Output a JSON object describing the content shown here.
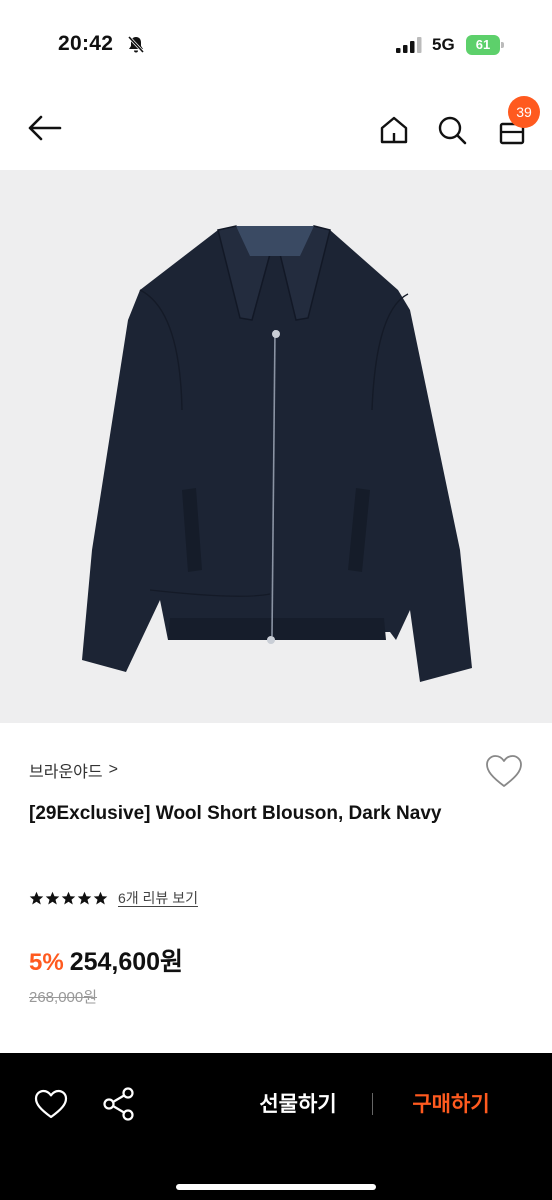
{
  "status_bar": {
    "time": "20:42",
    "network": "5G",
    "battery": "61"
  },
  "nav": {
    "cart_count": "39"
  },
  "product": {
    "brand": "브라운야드",
    "brand_chevron": ">",
    "title": "[29Exclusive] Wool Short Blouson, Dark Navy",
    "rating_stars": 5,
    "review_link": "6개 리뷰 보기",
    "discount": "5%",
    "sale_price": "254,600원",
    "original_price": "268,000원"
  },
  "bottom_bar": {
    "gift_label": "선물하기",
    "buy_label": "구매하기"
  },
  "colors": {
    "accent": "#ff5a1f",
    "jacket": "#1c2434",
    "image_bg": "#eeeeef"
  }
}
